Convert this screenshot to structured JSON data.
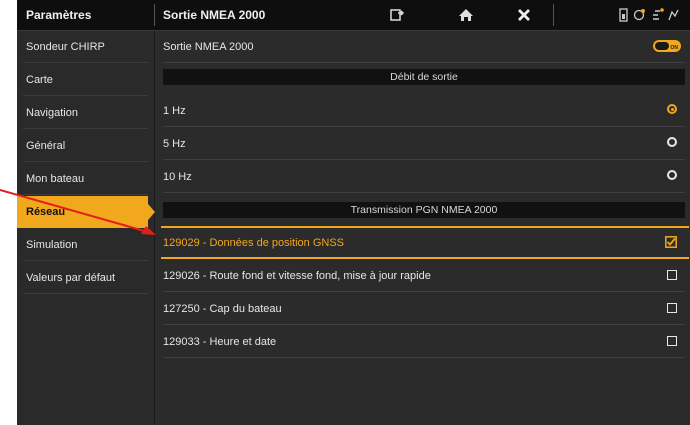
{
  "topbar": {
    "left_title": "Paramètres",
    "page_title": "Sortie NMEA 2000",
    "icons": [
      "screen-toggle-icon",
      "home-icon",
      "close-icon",
      "status-icons"
    ]
  },
  "sidebar": {
    "items": [
      {
        "label": "Sondeur CHIRP",
        "active": false
      },
      {
        "label": "Carte",
        "active": false
      },
      {
        "label": "Navigation",
        "active": false
      },
      {
        "label": "Général",
        "active": false
      },
      {
        "label": "Mon bateau",
        "active": false
      },
      {
        "label": "Réseau",
        "active": true
      },
      {
        "label": "Simulation",
        "active": false
      },
      {
        "label": "Valeurs par défaut",
        "active": false
      }
    ]
  },
  "content": {
    "output_row": {
      "label": "Sortie NMEA 2000",
      "toggle_text": "ON",
      "toggle_on": true
    },
    "rate_header": "Débit de sortie",
    "rates": [
      {
        "label": "1 Hz",
        "selected": true
      },
      {
        "label": "5 Hz",
        "selected": false
      },
      {
        "label": "10 Hz",
        "selected": false
      }
    ],
    "pgn_header": "Transmission PGN NMEA 2000",
    "pgns": [
      {
        "label": "129029 - Données de position GNSS",
        "checked": true,
        "highlight": true
      },
      {
        "label": "129026 - Route fond et vitesse fond, mise à jour rapide",
        "checked": false,
        "highlight": false
      },
      {
        "label": "127250 - Cap du bateau",
        "checked": false,
        "highlight": false
      },
      {
        "label": "129033 - Heure et date",
        "checked": false,
        "highlight": false
      }
    ]
  },
  "colors": {
    "accent": "#f2a81d",
    "background": "#2b2b2b",
    "annotation": "#e0201a"
  }
}
